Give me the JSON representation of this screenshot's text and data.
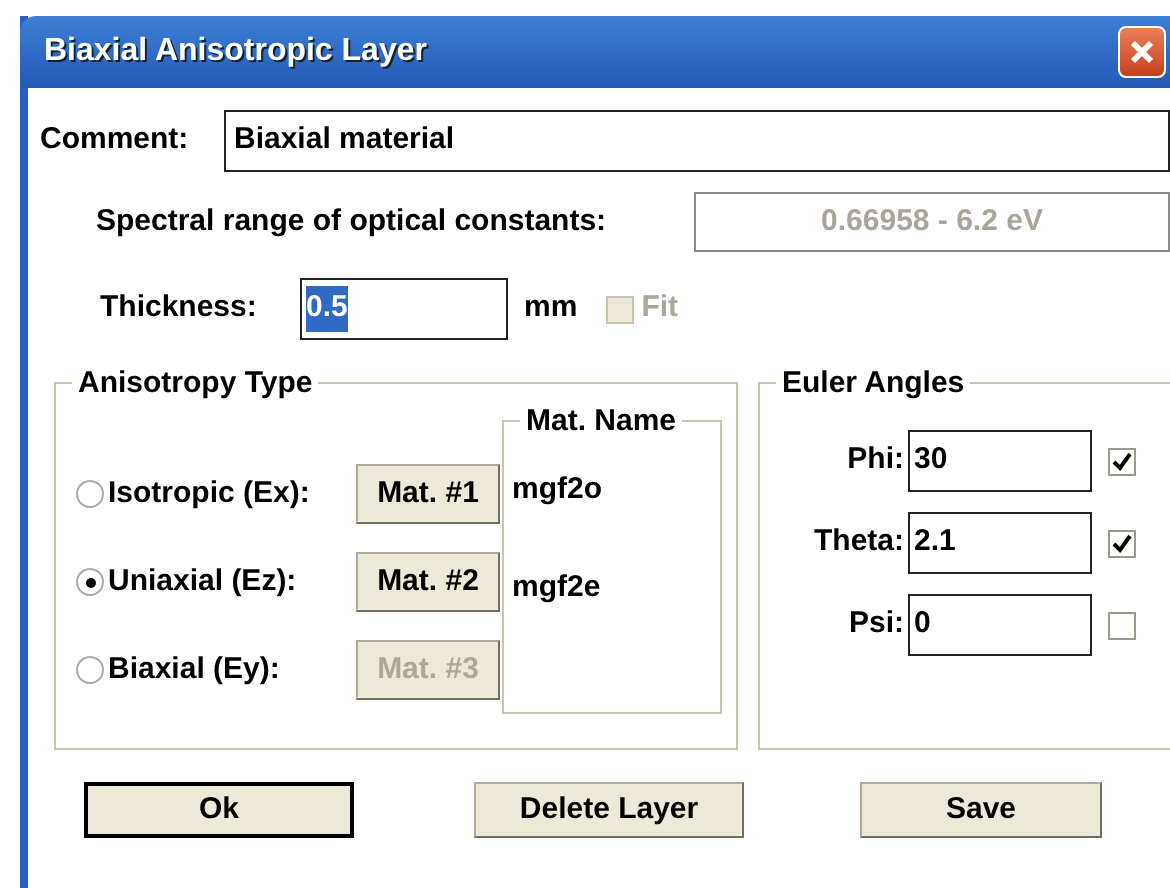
{
  "window": {
    "title": "Biaxial Anisotropic Layer"
  },
  "comment": {
    "label": "Comment:",
    "value": "Biaxial material"
  },
  "spectral_range": {
    "label": "Spectral range of optical constants:",
    "value": "0.66958 - 6.2 eV",
    "disabled": true
  },
  "thickness": {
    "label": "Thickness:",
    "value": "0.5",
    "text_selected": true,
    "unit": "mm",
    "fit": {
      "label": "Fit",
      "checked": false,
      "disabled": true
    }
  },
  "anisotropy_type": {
    "title": "Anisotropy Type",
    "options": [
      {
        "label": "Isotropic (Ex):",
        "selected": false,
        "button": "Mat. #1",
        "button_disabled": false
      },
      {
        "label": "Uniaxial (Ez):",
        "selected": true,
        "button": "Mat. #2",
        "button_disabled": false
      },
      {
        "label": "Biaxial (Ey):",
        "selected": false,
        "button": "Mat. #3",
        "button_disabled": true
      }
    ],
    "mat_name": {
      "title": "Mat. Name",
      "names": [
        "mgf2o",
        "mgf2e"
      ]
    }
  },
  "euler_angles": {
    "title": "Euler Angles",
    "angles": [
      {
        "label": "Phi:",
        "value": "30",
        "checked": true
      },
      {
        "label": "Theta:",
        "value": "2.1",
        "checked": true
      },
      {
        "label": "Psi:",
        "value": "0",
        "checked": false
      }
    ]
  },
  "buttons": [
    {
      "label": "Ok",
      "default": true
    },
    {
      "label": "Delete Layer",
      "default": false
    },
    {
      "label": "Save",
      "default": false
    }
  ]
}
